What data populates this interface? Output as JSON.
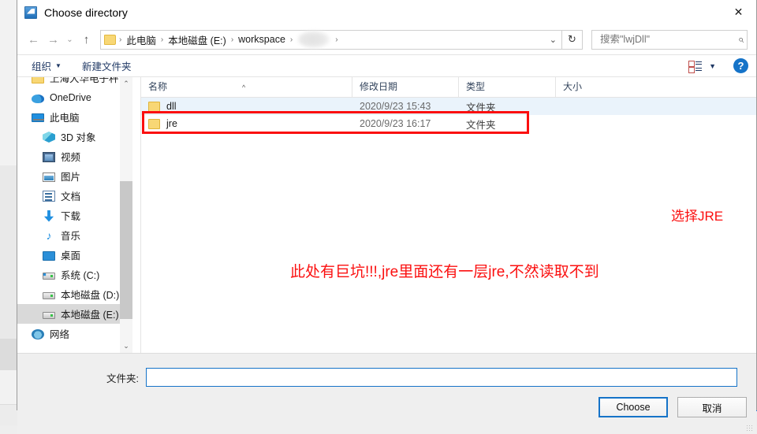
{
  "window": {
    "title": "Choose directory",
    "icon": "app-window-icon",
    "close_label": "✕"
  },
  "address_bar": {
    "back_icon": "arrow-left-icon",
    "forward_icon": "arrow-right-icon",
    "recent_icon": "chevron-down-icon",
    "up_icon": "arrow-up-icon",
    "crumbs": [
      {
        "label": "此电脑",
        "type": "text"
      },
      {
        "label": "本地磁盘 (E:)",
        "type": "text"
      },
      {
        "label": "workspace",
        "type": "text"
      },
      {
        "label": "",
        "type": "redacted"
      }
    ],
    "separator": "›",
    "dropdown_icon": "chevron-down-icon",
    "refresh_icon": "refresh-icon",
    "refresh_glyph": "↻"
  },
  "search": {
    "value": "搜索\"lwjDll\"",
    "placeholder": "搜索\"lwjDll\"",
    "icon": "search-icon",
    "glyph": "⌕"
  },
  "toolbar": {
    "organize_label": "组织",
    "organize_caret": "▼",
    "new_folder_label": "新建文件夹",
    "view_icon": "view-options-icon",
    "view_caret": "▼",
    "help_label": "?",
    "help_icon": "help-icon"
  },
  "nav_pane": {
    "items": [
      {
        "label": "上海大华电子秤",
        "icon": "folder-icon",
        "indent": false,
        "selected": false
      },
      {
        "label": "OneDrive",
        "icon": "cloud-icon",
        "indent": false,
        "selected": false
      },
      {
        "label": "此电脑",
        "icon": "this-pc-icon",
        "indent": false,
        "selected": false
      },
      {
        "label": "3D 对象",
        "icon": "3d-objects-icon",
        "indent": true,
        "selected": false
      },
      {
        "label": "视频",
        "icon": "videos-icon",
        "indent": true,
        "selected": false
      },
      {
        "label": "图片",
        "icon": "pictures-icon",
        "indent": true,
        "selected": false
      },
      {
        "label": "文档",
        "icon": "documents-icon",
        "indent": true,
        "selected": false
      },
      {
        "label": "下载",
        "icon": "downloads-icon",
        "indent": true,
        "selected": false
      },
      {
        "label": "音乐",
        "icon": "music-icon",
        "indent": true,
        "selected": false
      },
      {
        "label": "桌面",
        "icon": "desktop-icon",
        "indent": true,
        "selected": false
      },
      {
        "label": "系统 (C:)",
        "icon": "system-drive-icon",
        "indent": true,
        "selected": false
      },
      {
        "label": "本地磁盘 (D:)",
        "icon": "drive-icon",
        "indent": true,
        "selected": false
      },
      {
        "label": "本地磁盘 (E:)",
        "icon": "drive-icon",
        "indent": true,
        "selected": true
      },
      {
        "label": "网络",
        "icon": "network-icon",
        "indent": false,
        "selected": false
      }
    ],
    "scroll_up_icon": "chevron-up-icon",
    "scroll_down_icon": "chevron-down-icon",
    "scroll_up_glyph": "⌃",
    "scroll_down_glyph": "⌄"
  },
  "file_list": {
    "columns": [
      {
        "label": "名称",
        "key": "name"
      },
      {
        "label": "修改日期",
        "key": "date"
      },
      {
        "label": "类型",
        "key": "type"
      },
      {
        "label": "大小",
        "key": "size"
      }
    ],
    "sort_indicator": "^",
    "rows": [
      {
        "name": "dll",
        "date": "2020/9/23 15:43",
        "type": "文件夹",
        "size": "",
        "hover": true
      },
      {
        "name": "jre",
        "date": "2020/9/23 16:17",
        "type": "文件夹",
        "size": "",
        "hover": false
      }
    ]
  },
  "annotations": {
    "color": "#fb0f0f",
    "label_jre": "选择JRE",
    "note": "此处有巨坑!!!,jre里面还有一层jre,不然读取不到",
    "highlight_target": "jre"
  },
  "footer": {
    "folder_label": "文件夹:",
    "folder_value": "",
    "folder_placeholder": "",
    "choose_label": "Choose",
    "cancel_label": "取消"
  }
}
